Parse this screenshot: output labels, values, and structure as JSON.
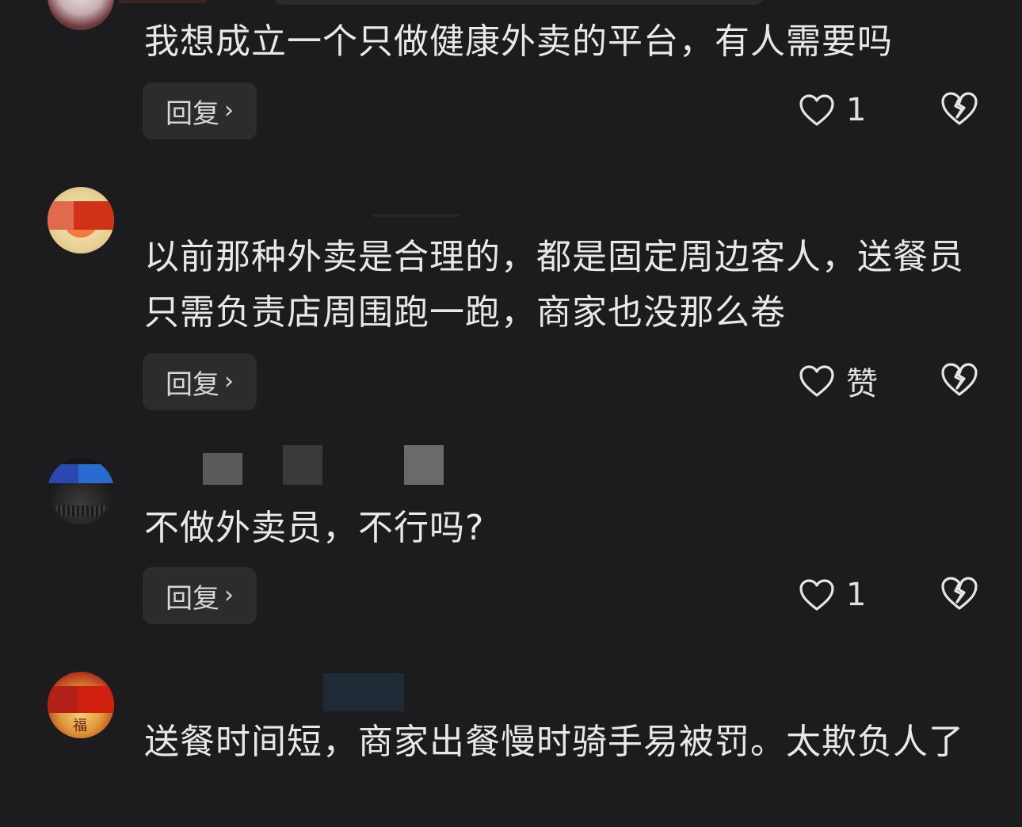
{
  "comments": [
    {
      "text": "我想成立一个只做健康外卖的平台，有人需要吗",
      "reply_label": "回复",
      "like_count": "1"
    },
    {
      "text": "以前那种外卖是合理的，都是固定周边客人，送餐员只需负责店周围跑一跑，商家也没那么卷",
      "reply_label": "回复",
      "like_count": "赞"
    },
    {
      "text": "不做外卖员，不行吗?",
      "reply_label": "回复",
      "like_count": "1"
    },
    {
      "text": "送餐时间短，商家出餐慢时骑手易被罚。太欺负人了"
    }
  ],
  "icons": {
    "reply_chevron": "chevron-right-icon",
    "like": "heart-outline-icon",
    "dislike": "broken-heart-icon"
  },
  "colors": {
    "background": "#1c1c1e",
    "button_bg": "#2c2c2e",
    "text": "#e8e8e8"
  }
}
